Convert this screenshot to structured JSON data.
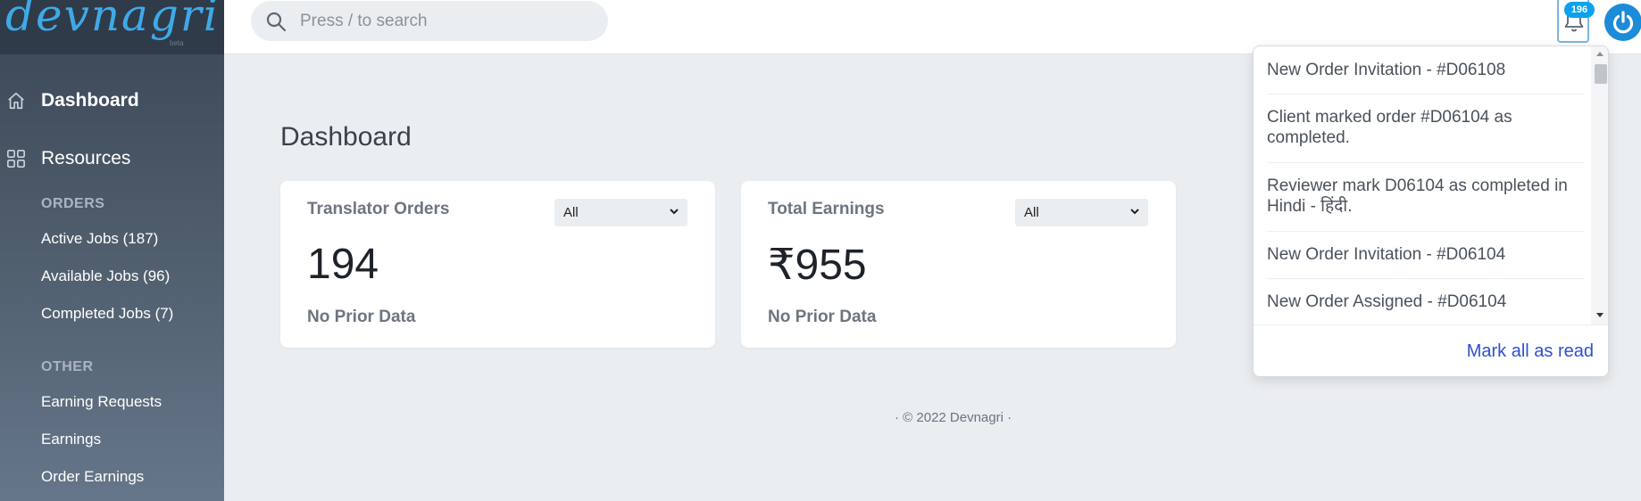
{
  "app": {
    "logo_text": "devnagri",
    "logo_tag": "beta",
    "brand_color": "#3fa9e8"
  },
  "sidebar": {
    "primary": [
      {
        "label": "Dashboard",
        "icon": "home-icon",
        "active": true
      },
      {
        "label": "Resources",
        "icon": "grid-icon",
        "active": false
      }
    ],
    "orders_heading": "ORDERS",
    "orders": [
      "Active Jobs (187)",
      "Available Jobs (96)",
      "Completed Jobs (7)"
    ],
    "other_heading": "OTHER",
    "other": [
      "Earning Requests",
      "Earnings",
      "Order Earnings"
    ]
  },
  "topbar": {
    "search_placeholder": "Press / to search",
    "notification_count": "196",
    "badge_color": "#0da1ef",
    "power_color": "#1c8bd9"
  },
  "main": {
    "title": "Dashboard",
    "cards": [
      {
        "title": "Translator Orders",
        "filter": "All",
        "value": "194",
        "note": "No Prior Data"
      },
      {
        "title": "Total Earnings",
        "filter": "All",
        "value": "₹955",
        "note": "No Prior Data"
      }
    ],
    "footer": "·  © 2022 Devnagri  ·"
  },
  "notifications": {
    "items": [
      "New Order Invitation - #D06108",
      "Client marked order #D06104 as completed.",
      "Reviewer mark D06104 as completed in Hindi - हिंदी.",
      "New Order Invitation - #D06104",
      "New Order Assigned - #D06104"
    ],
    "mark_all_label": "Mark all as read",
    "link_color": "#2f4fd6"
  }
}
